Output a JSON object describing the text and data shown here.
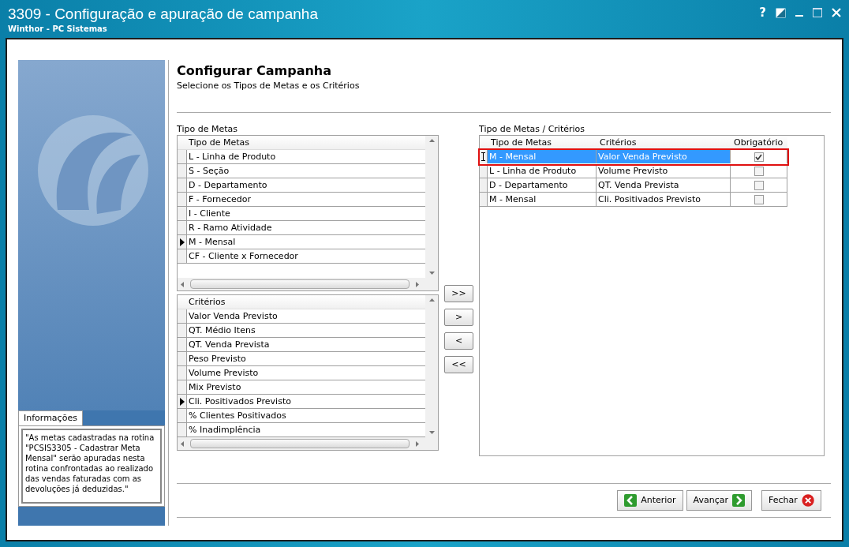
{
  "window": {
    "title": "3309 - Configuração e apuração de campanha",
    "subtitle": "Winthor - PC Sistemas",
    "help": "?"
  },
  "page": {
    "title": "Configurar Campanha",
    "subtitle": "Selecione os Tipos de Metas e os Critérios"
  },
  "info": {
    "tab": "Informações",
    "text": "\"As metas cadastradas na rotina \"PCSIS3305 - Cadastrar Meta Mensal\" serão apuradas nesta rotina confrontadas ao realizado das vendas faturadas com as devoluções já deduzidas.\""
  },
  "tipo_metas": {
    "label": "Tipo de Metas",
    "column": "Tipo de Metas",
    "rows": [
      {
        "text": "L - Linha de Produto",
        "current": false
      },
      {
        "text": "S - Seção",
        "current": false
      },
      {
        "text": "D - Departamento",
        "current": false
      },
      {
        "text": "F - Fornecedor",
        "current": false
      },
      {
        "text": "I - Cliente",
        "current": false
      },
      {
        "text": "R - Ramo Atividade",
        "current": false
      },
      {
        "text": "M - Mensal",
        "current": true
      },
      {
        "text": "CF - Cliente x Fornecedor",
        "current": false
      }
    ]
  },
  "criterios": {
    "column": "Critérios",
    "rows": [
      {
        "text": "Valor Venda Previsto",
        "current": false
      },
      {
        "text": "QT. Médio Itens",
        "current": false
      },
      {
        "text": "QT. Venda Prevista",
        "current": false
      },
      {
        "text": "Peso Previsto",
        "current": false
      },
      {
        "text": "Volume Previsto",
        "current": false
      },
      {
        "text": "Mix Previsto",
        "current": false
      },
      {
        "text": "Cli. Positivados Previsto",
        "current": true
      },
      {
        "text": "% Clientes Positivados",
        "current": false
      },
      {
        "text": "% Inadimplência",
        "current": false
      }
    ]
  },
  "move_buttons": [
    ">>",
    ">",
    "<",
    "<<"
  ],
  "selected_grid": {
    "label": "Tipo de Metas / Critérios",
    "columns": [
      "Tipo de Metas",
      "Critérios",
      "Obrigatório"
    ],
    "rows": [
      {
        "tipo": "M - Mensal",
        "criterio": "Valor Venda Previsto",
        "obrigatorio": true,
        "selected": true
      },
      {
        "tipo": "L - Linha de Produto",
        "criterio": "Volume Previsto",
        "obrigatorio": false,
        "selected": false
      },
      {
        "tipo": "D - Departamento",
        "criterio": "QT. Venda Prevista",
        "obrigatorio": false,
        "selected": false
      },
      {
        "tipo": "M - Mensal",
        "criterio": "Cli. Positivados Previsto",
        "obrigatorio": false,
        "selected": false
      }
    ]
  },
  "buttons": [
    {
      "kind": "back",
      "label": "Anterior"
    },
    {
      "kind": "next",
      "label": "Avançar"
    },
    {
      "kind": "close",
      "label": "Fechar"
    }
  ]
}
